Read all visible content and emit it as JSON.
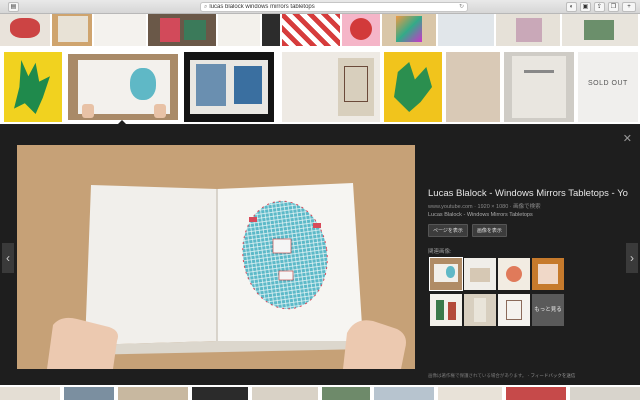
{
  "browser": {
    "url": "lucas blalock windows mirrors tabletops",
    "search_icon": "magnifier-icon",
    "reload_icon": "reload-icon"
  },
  "preview": {
    "title": "Lucas Blalock - Windows Mirrors Tabletops - Yo...",
    "meta": "www.youtube.com  ·  1920 × 1080  ·  画像で検索",
    "subtitle": "Lucas Blalock - Windows Mirrors Tabletops",
    "buttons": [
      "ページを表示",
      "画像を表示"
    ],
    "related_label": "関連画像:",
    "more_label": "もっと見る",
    "footer": "画像は著作権で保護されている場合があります。",
    "feedback": "フィードバックを送信"
  },
  "strip2": {
    "sold_out": "SOLD OUT"
  },
  "colors": {
    "panel_bg": "#1e1e1e",
    "accent": "#1a9fc4"
  }
}
